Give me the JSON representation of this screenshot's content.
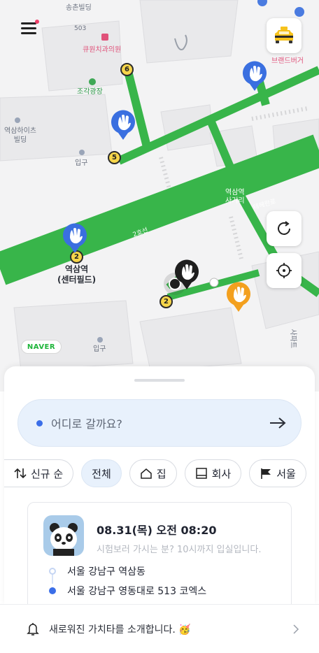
{
  "map": {
    "labels": {
      "building_top": "송촌빌딩",
      "addr_503": "503",
      "dental": "큐원치과의원",
      "plaza": "조각광장",
      "burger": "브랜드버거",
      "heights_line1": "역삼하이츠",
      "heights_line2": "빌딩",
      "entrance1": "입구",
      "entrance2": "입구",
      "station_line1": "역삼역",
      "station_line2": "(센터필드)",
      "intersection_line1": "역삼역",
      "intersection_line2": "사거리",
      "teheran": "테헤란로",
      "road_number": "2호선",
      "right_building": "사파트"
    },
    "stop_numbers": [
      "6",
      "5",
      "2",
      "2",
      "2"
    ],
    "naver_logo": "NAVER",
    "colors": {
      "road": "#38b54a",
      "pin_blue": "#3a6fe0",
      "pin_black": "#1e1e1e",
      "pin_orange": "#f3a01e"
    }
  },
  "icons": {
    "menu": "hamburger-icon",
    "taxi": "taxi-icon",
    "refresh": "refresh-icon",
    "locate": "crosshair-icon",
    "pin": "hand-wave-pin-icon",
    "arrow": "arrow-right-icon",
    "bell": "bell-icon",
    "chevron": "chevron-right-icon"
  },
  "search": {
    "placeholder": "어디로 갈까요?"
  },
  "chips": {
    "sort": "신규 순",
    "all": "전체",
    "home": "집",
    "work": "회사",
    "flag": "서울"
  },
  "card": {
    "time": "08.31(목) 오전 08:20",
    "message": "시험보러 가시는 분? 10시까지 입실입니다.",
    "origin": "서울 강남구 역삼동",
    "destination": "서울 강남구 영동대로 513 코엑스"
  },
  "banner": {
    "text": "새로워진 가치타를 소개합니다. 🥳"
  }
}
